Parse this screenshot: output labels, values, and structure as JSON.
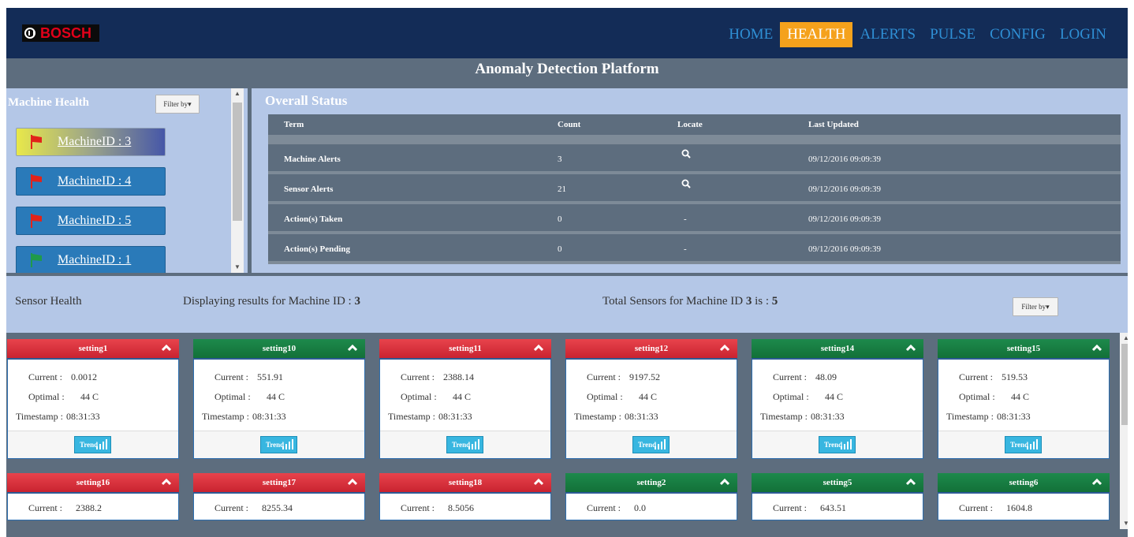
{
  "brand": {
    "name": "BOSCH",
    "accent": "#e2001a"
  },
  "nav": {
    "items": [
      {
        "label": "HOME",
        "active": false
      },
      {
        "label": "HEALTH",
        "active": true
      },
      {
        "label": "ALERTS",
        "active": false
      },
      {
        "label": "PULSE",
        "active": false
      },
      {
        "label": "CONFIG",
        "active": false
      },
      {
        "label": "LOGIN",
        "active": false
      }
    ],
    "active_color": "#f5a21c",
    "link_color": "#2f8fd5"
  },
  "page_title": "Anomaly Detection Platform",
  "machine_health": {
    "title": "Machine Health",
    "filter_label": "Filter by▾",
    "machines": [
      {
        "label": "MachineID : 3",
        "flag": "red",
        "selected": true
      },
      {
        "label": "MachineID : 4",
        "flag": "red",
        "selected": false
      },
      {
        "label": "MachineID : 5",
        "flag": "red",
        "selected": false
      },
      {
        "label": "MachineID : 1",
        "flag": "green",
        "selected": false
      }
    ]
  },
  "overall_status": {
    "title": "Overall Status",
    "headers": [
      "Term",
      "Count",
      "Locate",
      "Last Updated"
    ],
    "rows": [
      {
        "term": "Machine Alerts",
        "count": "3",
        "locate": "search-icon",
        "updated": "09/12/2016 09:09:39"
      },
      {
        "term": "Sensor Alerts",
        "count": "21",
        "locate": "search-icon",
        "updated": "09/12/2016 09:09:39"
      },
      {
        "term": "Action(s) Taken",
        "count": "0",
        "locate": "-",
        "updated": "09/12/2016 09:09:39"
      },
      {
        "term": "Action(s) Pending",
        "count": "0",
        "locate": "-",
        "updated": "09/12/2016 09:09:39"
      }
    ]
  },
  "sensor_health": {
    "title": "Sensor Health",
    "display_prefix": "Displaying results for Machine ID : ",
    "display_machine": "3",
    "total_prefix": "Total Sensors for Machine ID ",
    "total_machine": "3",
    "total_mid": " is : ",
    "total_count": "5",
    "filter_label": "Filter by▾"
  },
  "sensor_labels": {
    "current": "Current :",
    "optimal": "Optimal :",
    "timestamp": "Timestamp :",
    "trend": "Trend"
  },
  "sensors_row1": [
    {
      "name": "setting1",
      "status": "red",
      "current": "0.0012",
      "optimal": "44 C",
      "timestamp": "08:31:33"
    },
    {
      "name": "setting10",
      "status": "green",
      "current": "551.91",
      "optimal": "44 C",
      "timestamp": "08:31:33"
    },
    {
      "name": "setting11",
      "status": "red",
      "current": "2388.14",
      "optimal": "44 C",
      "timestamp": "08:31:33"
    },
    {
      "name": "setting12",
      "status": "red",
      "current": "9197.52",
      "optimal": "44 C",
      "timestamp": "08:31:33"
    },
    {
      "name": "setting14",
      "status": "green",
      "current": "48.09",
      "optimal": "44 C",
      "timestamp": "08:31:33"
    },
    {
      "name": "setting15",
      "status": "green",
      "current": "519.53",
      "optimal": "44 C",
      "timestamp": "08:31:33"
    }
  ],
  "sensors_row2": [
    {
      "name": "setting16",
      "status": "red",
      "current": "2388.2"
    },
    {
      "name": "setting17",
      "status": "red",
      "current": "8255.34"
    },
    {
      "name": "setting18",
      "status": "red",
      "current": "8.5056"
    },
    {
      "name": "setting2",
      "status": "green",
      "current": "0.0"
    },
    {
      "name": "setting5",
      "status": "green",
      "current": "643.51"
    },
    {
      "name": "setting6",
      "status": "green",
      "current": "1604.8"
    }
  ]
}
